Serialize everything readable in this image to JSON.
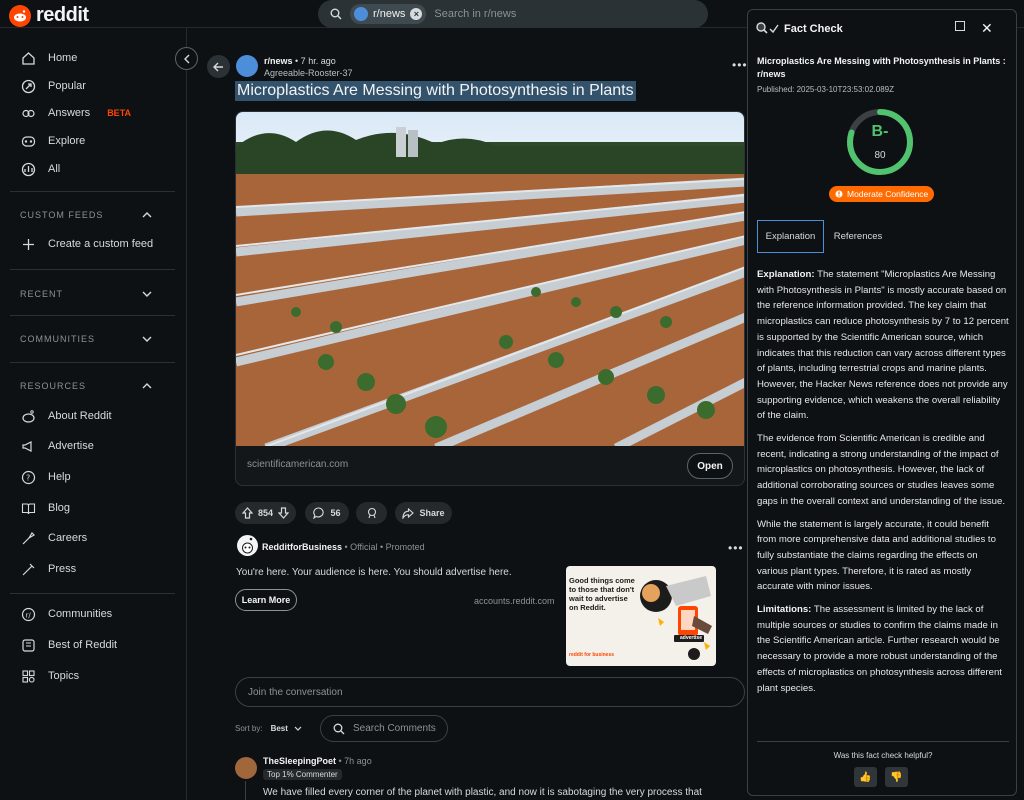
{
  "header": {
    "logo_text": "reddit",
    "search_chip": "r/news",
    "search_placeholder": "Search in r/news"
  },
  "sidebar": {
    "items": [
      {
        "label": "Home",
        "icon": "home-icon"
      },
      {
        "label": "Popular",
        "icon": "popular-icon"
      },
      {
        "label": "Answers",
        "icon": "answers-icon",
        "badge": "BETA"
      },
      {
        "label": "Explore",
        "icon": "explore-icon"
      },
      {
        "label": "All",
        "icon": "all-icon"
      }
    ],
    "custom_feeds_head": "CUSTOM FEEDS",
    "create_feed": "Create a custom feed",
    "recent_head": "RECENT",
    "communities_head": "COMMUNITIES",
    "resources_head": "RESOURCES",
    "resources": [
      {
        "label": "About Reddit",
        "icon": "about-icon"
      },
      {
        "label": "Advertise",
        "icon": "advertise-icon"
      },
      {
        "label": "Help",
        "icon": "help-icon"
      },
      {
        "label": "Blog",
        "icon": "blog-icon"
      },
      {
        "label": "Careers",
        "icon": "careers-icon"
      },
      {
        "label": "Press",
        "icon": "press-icon"
      }
    ],
    "bottom": [
      {
        "label": "Communities",
        "icon": "communities-icon"
      },
      {
        "label": "Best of Reddit",
        "icon": "best-icon"
      },
      {
        "label": "Topics",
        "icon": "topics-icon"
      }
    ]
  },
  "post": {
    "subreddit": "r/news",
    "time": "• 7 hr. ago",
    "author": "Agreeable-Rooster-37",
    "title": "Microplastics Are Messing with Photosynthesis in Plants",
    "link_domain": "scientificamerican.com",
    "open_label": "Open",
    "votes": "854",
    "comments": "56",
    "share": "Share"
  },
  "ad": {
    "name": "RedditforBusiness",
    "meta": " • Official • Promoted",
    "text": "You're here. Your audience is here. You should advertise here.",
    "learn_more": "Learn More",
    "domain": "accounts.reddit.com",
    "image_text": "Good things come to those that don't wait to advertise on Reddit.",
    "image_brand": "reddit for business",
    "image_tag": "advertise"
  },
  "comments_area": {
    "join_placeholder": "Join the conversation",
    "sort_label": "Sort by:",
    "sort_value": "Best",
    "search_comments": "Search Comments"
  },
  "comment": {
    "user": "TheSleepingPoet",
    "time": " • 7h ago",
    "badge": "Top 1% Commenter",
    "text": "We have filled every corner of the planet with plastic, and now it is sabotaging the very process that"
  },
  "fact_check": {
    "title": "Fact Check",
    "subject": "Microplastics Are Messing with Photosynthesis in Plants : r/news",
    "published": "Published: 2025-03-10T23:53:02.089Z",
    "grade": "B-",
    "score": "80",
    "score_fraction": 0.8,
    "confidence": "Moderate Confidence",
    "tabs": [
      "Explanation",
      "References"
    ],
    "explanation_label": "Explanation:",
    "explanation_1": "The statement \"Microplastics Are Messing with Photosynthesis in Plants\" is mostly accurate based on the reference information provided. The key claim that microplastics can reduce photosynthesis by 7 to 12 percent is supported by the Scientific American source, which indicates that this reduction can vary across different types of plants, including terrestrial crops and marine plants. However, the Hacker News reference does not provide any supporting evidence, which weakens the overall reliability of the claim.",
    "explanation_2": "The evidence from Scientific American is credible and recent, indicating a strong understanding of the impact of microplastics on photosynthesis. However, the lack of additional corroborating sources or studies leaves some gaps in the overall context and understanding of the issue.",
    "explanation_3": "While the statement is largely accurate, it could benefit from more comprehensive data and additional studies to fully substantiate the claims regarding the effects on various plant types. Therefore, it is rated as mostly accurate with minor issues.",
    "limitations_label": "Limitations:",
    "limitations": "The assessment is limited by the lack of multiple sources or studies to confirm the claims made in the Scientific American article. Further research would be necessary to provide a more robust understanding of the effects of microplastics on photosynthesis across different plant species.",
    "helpful_q": "Was this fact check helpful?",
    "thumb_up": "👍",
    "thumb_down": "👎"
  },
  "colors": {
    "accent": "#ff4500",
    "gauge": "#51c26e",
    "confidence": "#ff6b00",
    "tab_border": "#4d8edb"
  }
}
